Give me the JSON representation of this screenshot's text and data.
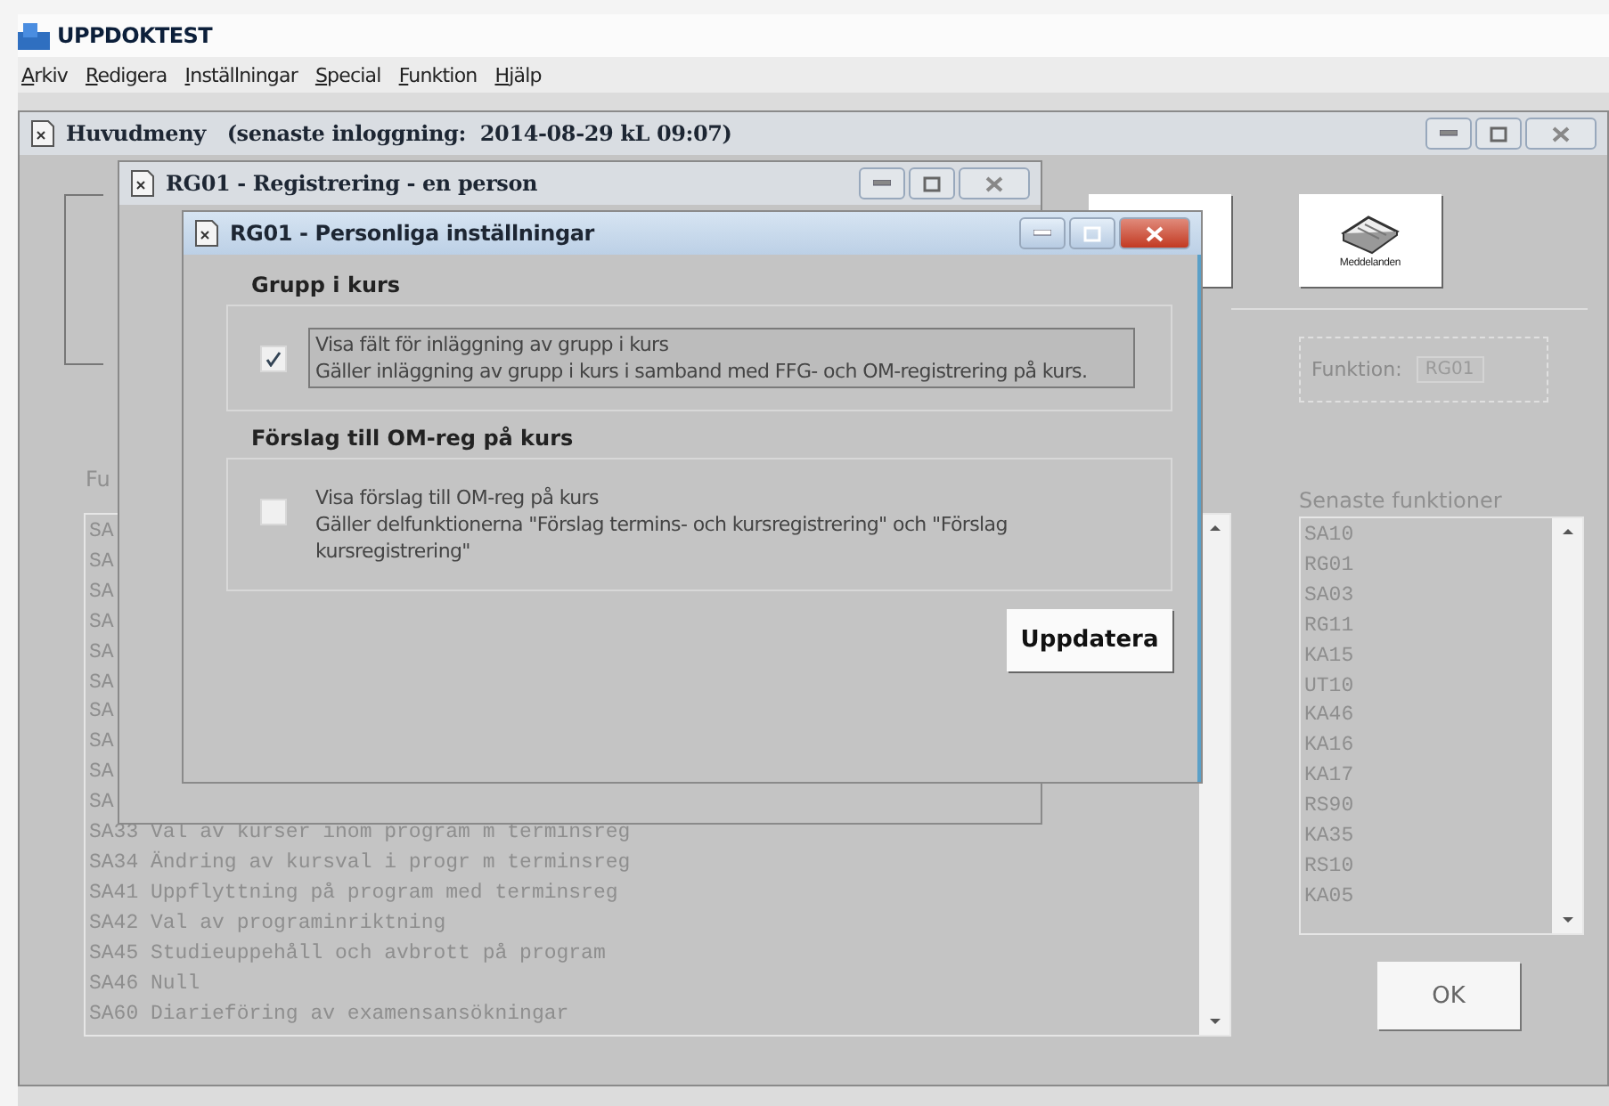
{
  "app": {
    "title": "UPPDOKTEST"
  },
  "menu": [
    {
      "label": "Arkiv"
    },
    {
      "label": "Redigera"
    },
    {
      "label": "Inställningar"
    },
    {
      "label": "Special"
    },
    {
      "label": "Funktion"
    },
    {
      "label": "Hjälp"
    }
  ],
  "main_window": {
    "title": "Huvudmeny   (senaste inloggning:  2014-08-29 kL 09:07)",
    "toolbar_button": {
      "label": "Meddelanden"
    },
    "function_field": {
      "label": "Funktion:",
      "value": "RG01"
    },
    "functions_list": {
      "label": "Fu",
      "items": [
        "SA",
        "SA",
        "SA",
        "SA",
        "SA",
        "SA",
        "SA",
        "SA",
        "SA",
        "SA",
        "SA33 Val av kurser inom program m terminsreg",
        "SA34 Ändring av kursval i progr m terminsreg",
        "SA41 Uppflyttning på program med terminsreg",
        "SA42 Val av programinriktning",
        "SA45 Studieuppehåll och avbrott på program",
        "SA46 Null",
        "SA60 Diarieföring av examensansökningar"
      ]
    },
    "recent_list": {
      "label": "Senaste funktioner",
      "items": [
        "SA10",
        "RG01",
        "SA03",
        "RG11",
        "KA15",
        "UT10",
        "KA46",
        "KA16",
        "KA17",
        "RS90",
        "KA35",
        "RS10",
        "KA05"
      ]
    },
    "ok_button": "OK"
  },
  "registration_window": {
    "title": "RG01 - Registrering - en person"
  },
  "dialog": {
    "title": "RG01 - Personliga inställningar",
    "groups": [
      {
        "title": "Grupp i kurs",
        "option": {
          "label": "Visa fält för inläggning av grupp i kurs",
          "description": "Gäller inläggning av grupp i kurs i samband med FFG- och OM-registrering på kurs.",
          "checked": true,
          "focused": true
        }
      },
      {
        "title": "Förslag till OM-reg på kurs",
        "option": {
          "label": "Visa förslag till OM-reg på kurs",
          "description": "Gäller delfunktionerna \"Förslag termins- och kursregistrering\" och \"Förslag kursregistrering\"",
          "checked": false,
          "focused": false
        }
      }
    ],
    "button": "Uppdatera"
  }
}
